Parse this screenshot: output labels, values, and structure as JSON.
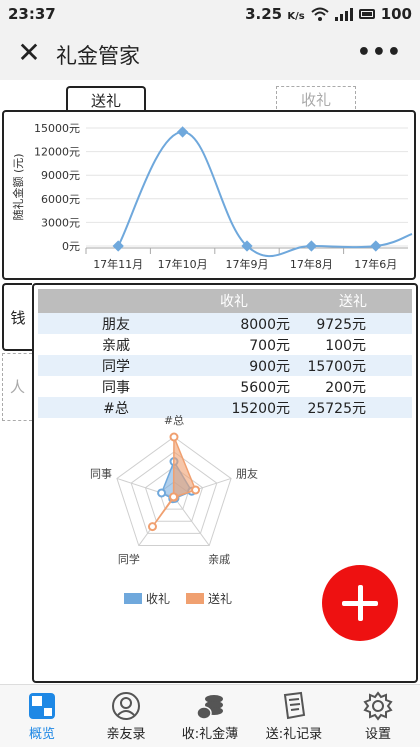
{
  "status_bar": {
    "time": "23:37",
    "speed": "3.25",
    "speed_unit": "K/s",
    "battery": "100"
  },
  "header": {
    "title": "礼金管家"
  },
  "top_tabs": [
    {
      "label": "送礼",
      "active": true
    },
    {
      "label": "收礼",
      "active": false
    }
  ],
  "side_tabs": [
    {
      "label": "钱",
      "active": true
    },
    {
      "label": "人",
      "active": false
    }
  ],
  "chart_data": [
    {
      "type": "line",
      "ylabel": "随礼金额 (元)",
      "categories": [
        "17年11月",
        "17年10月",
        "17年9月",
        "17年8月",
        "17年6月"
      ],
      "values": [
        0,
        14500,
        0,
        0,
        0
      ],
      "yticks": [
        "0元",
        "3000元",
        "6000元",
        "9000元",
        "12000元",
        "15000元"
      ],
      "ylim": [
        0,
        15000
      ],
      "color": "#6fa8dc",
      "smooth": true
    },
    {
      "type": "radar",
      "axes": [
        "#总",
        "朋友",
        "亲戚",
        "同学",
        "同事"
      ],
      "series": [
        {
          "name": "收礼",
          "values": [
            15200,
            8000,
            700,
            900,
            5600
          ],
          "color": "#6fa8dc"
        },
        {
          "name": "送礼",
          "values": [
            25725,
            9725,
            100,
            15700,
            200
          ],
          "color": "#f0a070"
        }
      ],
      "legend_position": "bottom"
    }
  ],
  "summary_table": {
    "headers": [
      "",
      "收礼",
      "送礼"
    ],
    "rows": [
      [
        "朋友",
        "8000元",
        "9725元"
      ],
      [
        "亲戚",
        "700元",
        "100元"
      ],
      [
        "同学",
        "900元",
        "15700元"
      ],
      [
        "同事",
        "5600元",
        "200元"
      ],
      [
        "#总",
        "15200元",
        "25725元"
      ]
    ]
  },
  "bottom_nav": [
    {
      "label": "概览",
      "icon": "overview-icon",
      "active": true
    },
    {
      "label": "亲友录",
      "icon": "contacts-icon",
      "active": false
    },
    {
      "label": "收:礼金薄",
      "icon": "coins-icon",
      "active": false
    },
    {
      "label": "送:礼记录",
      "icon": "notes-icon",
      "active": false
    },
    {
      "label": "设置",
      "icon": "gear-icon",
      "active": false
    }
  ],
  "colors": {
    "accent": "#1e88e5",
    "fab": "#ee1111"
  }
}
